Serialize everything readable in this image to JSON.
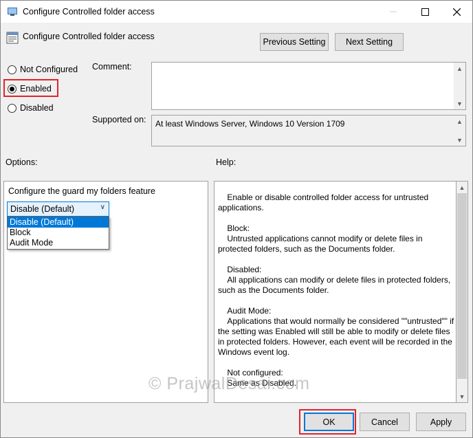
{
  "window": {
    "title": "Configure Controlled folder access",
    "header": "Configure Controlled folder access"
  },
  "nav": {
    "previous_label": "Previous Setting",
    "next_label": "Next Setting"
  },
  "state": {
    "options": [
      {
        "label": "Not Configured",
        "selected": false
      },
      {
        "label": "Enabled",
        "selected": true
      },
      {
        "label": "Disabled",
        "selected": false
      }
    ]
  },
  "comment": {
    "label": "Comment:",
    "value": ""
  },
  "supported": {
    "label": "Supported on:",
    "value": "At least Windows Server, Windows 10 Version 1709"
  },
  "options_section": {
    "label": "Options:",
    "setting_label": "Configure the guard my folders feature",
    "combo_value": "Disable (Default)",
    "dropdown_items": [
      "Disable (Default)",
      "Block",
      "Audit Mode"
    ]
  },
  "help": {
    "label": "Help:",
    "paragraphs": [
      "    Enable or disable controlled folder access for untrusted applications.",
      "    Block:\n    Untrusted applications cannot modify or delete files in protected folders, such as the Documents folder.",
      "    Disabled:\n    All applications can modify or delete files in protected folders, such as the Documents folder.",
      "    Audit Mode:\n    Applications that would normally be considered \"\"untrusted\"\" if the setting was Enabled will still be able to modify or delete files in protected folders. However, each event will be recorded in the Windows event log.",
      "    Not configured:\n    Same as Disabled."
    ]
  },
  "footer": {
    "ok_label": "OK",
    "cancel_label": "Cancel",
    "apply_label": "Apply"
  },
  "watermark": "© PrajwalDesai.com",
  "colors": {
    "highlight_red": "#e2232a",
    "selection_blue": "#0078d7"
  }
}
